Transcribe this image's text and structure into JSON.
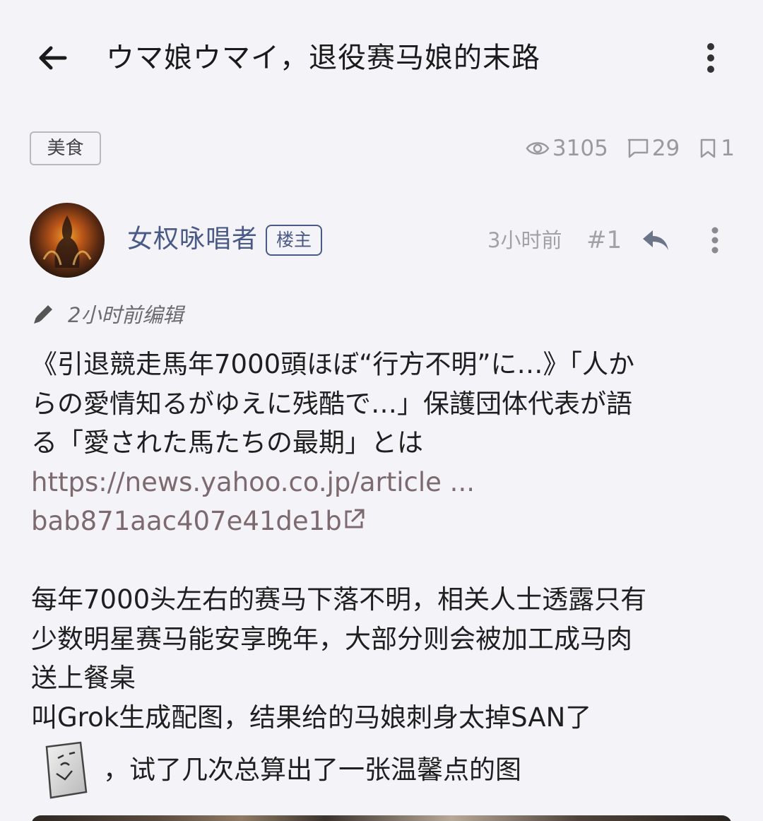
{
  "header": {
    "title": "ウマ娘ウマイ，退役赛马娘的末路"
  },
  "thread": {
    "tag": "美食",
    "views": "3105",
    "comments": "29",
    "bookmarks": "1"
  },
  "post": {
    "author": "女权咏唱者",
    "op_badge": "楼主",
    "time": "3小时前",
    "floor": "#1",
    "edited": "2小时前编辑",
    "lines": [
      "《引退競走馬年7000頭ほぼ“行方不明”に…》「人か",
      "らの愛情知るがゆえに残酷で…」保護団体代表が語",
      "る「愛された馬たちの最期」とは"
    ],
    "link_line1": "https://news.yahoo.co.jp/article ...",
    "link_line2": "bab871aac407e41de1b",
    "body_lines": [
      "每年7000头左右的赛马下落不明，相关人士透露只有",
      "少数明星赛马能安享晚年，大部分则会被加工成马肉",
      "送上餐桌",
      "叫Grok生成配图，结果给的马娘刺身太掉SAN了"
    ],
    "last_line": "，试了几次总算出了一张温馨点的图"
  },
  "icons": {
    "back": "arrow-left-icon",
    "more": "more-vert-icon",
    "views": "eye-icon",
    "comments": "comment-icon",
    "bookmarks": "bookmark-icon",
    "reply": "reply-icon",
    "edit": "pencil-icon",
    "external": "external-link-icon",
    "sticker": "sticker-icon"
  },
  "colors": {
    "background": "#f4f3f8",
    "author": "#4a5a86",
    "muted": "#a2a1a8",
    "link": "#7c6a6e"
  }
}
